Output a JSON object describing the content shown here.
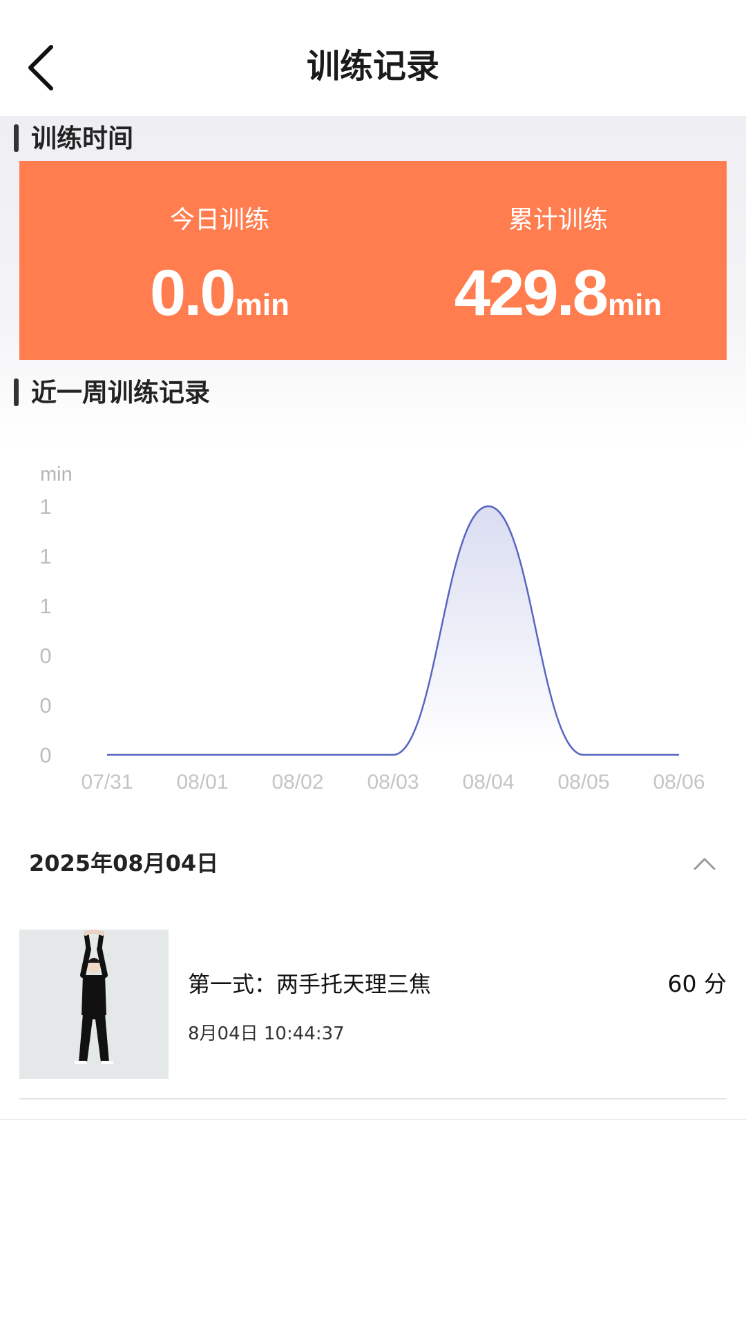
{
  "header": {
    "title": "训练记录",
    "back_icon": "chevron-left-icon"
  },
  "training_time": {
    "section_title": "训练时间",
    "card_color": "#ff7d4f",
    "today": {
      "label": "今日训练",
      "value": "0.0",
      "unit": "min"
    },
    "total": {
      "label": "累计训练",
      "value": "429.8",
      "unit": "min"
    }
  },
  "weekly": {
    "section_title": "近一周训练记录",
    "chart_data": {
      "type": "area",
      "ylabel": "min",
      "y_tick_labels": [
        "0",
        "0",
        "0",
        "1",
        "1",
        "1"
      ],
      "x": [
        "07/31",
        "08/01",
        "08/02",
        "08/03",
        "08/04",
        "08/05",
        "08/06"
      ],
      "values": [
        0,
        0,
        0,
        0,
        1,
        0,
        0
      ],
      "ylim": [
        0,
        1
      ],
      "line_color": "#5866c2",
      "grid": false,
      "smooth": true
    }
  },
  "day_group": {
    "date": "2025年08月04日",
    "collapse_icon": "chevron-up-icon",
    "records": [
      {
        "title": "第一式：两手托天理三焦",
        "score": "60 分",
        "time": "8月04日 10:44:37"
      }
    ]
  }
}
